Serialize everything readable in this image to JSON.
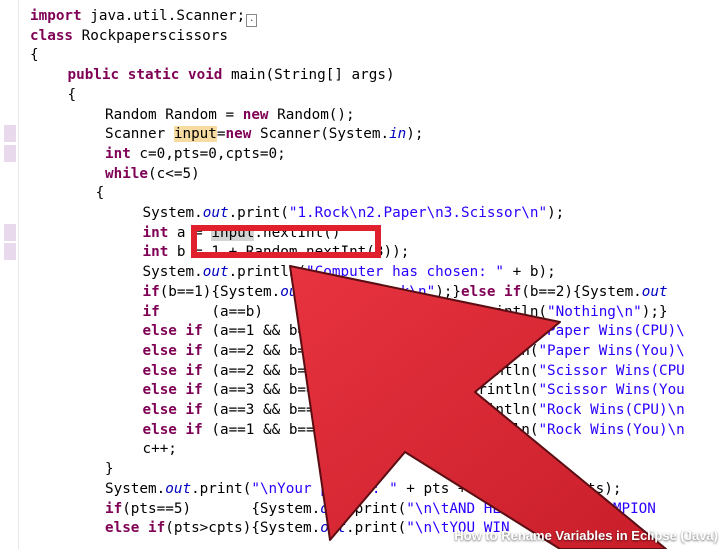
{
  "editor": {
    "lines": [
      {
        "indent": 0,
        "tokens": [
          [
            "kw",
            "import"
          ],
          [
            "t",
            " java.util.Scanner;"
          ]
        ],
        "fold": true
      },
      {
        "indent": 0,
        "tokens": [
          [
            "kw",
            "class"
          ],
          [
            "t",
            " Rockpaperscissors"
          ]
        ]
      },
      {
        "indent": 0,
        "tokens": [
          [
            "t",
            "{"
          ]
        ]
      },
      {
        "indent": 4,
        "tokens": [
          [
            "kw",
            "public static void"
          ],
          [
            "t",
            " main(String[] args)"
          ]
        ]
      },
      {
        "indent": 4,
        "tokens": [
          [
            "t",
            "{"
          ]
        ]
      },
      {
        "indent": 8,
        "tokens": [
          [
            "t",
            "Random Random = "
          ],
          [
            "kw",
            "new"
          ],
          [
            "t",
            " Random();"
          ]
        ]
      },
      {
        "indent": 8,
        "tokens": [
          [
            "t",
            "Scanner "
          ],
          [
            "occw",
            "input"
          ],
          [
            "t",
            "="
          ],
          [
            "kw",
            "new"
          ],
          [
            "t",
            " Scanner(System."
          ],
          [
            "fld",
            "in"
          ],
          [
            "t",
            ");"
          ]
        ],
        "mark": true
      },
      {
        "indent": 8,
        "tokens": [
          [
            "kw",
            "int"
          ],
          [
            "t",
            " c=0,pts=0,cpts=0;"
          ]
        ],
        "mark": true
      },
      {
        "indent": 8,
        "tokens": [
          [
            "kw",
            "while"
          ],
          [
            "t",
            "(c<=5)"
          ]
        ]
      },
      {
        "indent": 7,
        "tokens": [
          [
            "t",
            "{"
          ]
        ]
      },
      {
        "indent": 12,
        "tokens": [
          [
            "t",
            "System."
          ],
          [
            "fld",
            "out"
          ],
          [
            "t",
            ".print("
          ],
          [
            "str",
            "\"1.Rock\\n2.Paper\\n3.Scissor\\n\""
          ],
          [
            "t",
            ");"
          ]
        ]
      },
      {
        "indent": 12,
        "tokens": [
          [
            "kw",
            "int"
          ],
          [
            "t",
            " a = "
          ],
          [
            "occr",
            "input"
          ],
          [
            "t",
            ".nextInt()"
          ]
        ],
        "mark": true
      },
      {
        "indent": 12,
        "tokens": [
          [
            "kw",
            "int"
          ],
          [
            "t",
            " b = 1 + Random.nextInt(3));"
          ]
        ],
        "mark": true
      },
      {
        "indent": 12,
        "tokens": [
          [
            "t",
            "System."
          ],
          [
            "fld",
            "out"
          ],
          [
            "t",
            ".println("
          ],
          [
            "str",
            "\"Computer has chosen: \""
          ],
          [
            "t",
            " + b);"
          ]
        ]
      },
      {
        "indent": 12,
        "tokens": [
          [
            "kw",
            "if"
          ],
          [
            "t",
            "(b==1){System."
          ],
          [
            "fld",
            "out"
          ],
          [
            "t",
            ".print("
          ],
          [
            "str",
            "\"Rock\\n\""
          ],
          [
            "t",
            ");}"
          ],
          [
            "kw",
            "else if"
          ],
          [
            "t",
            "(b==2){System."
          ],
          [
            "fld",
            "out"
          ]
        ]
      },
      {
        "indent": 12,
        "tokens": [
          [
            "kw",
            "if"
          ],
          [
            "t",
            "      (a==b)                        .println("
          ],
          [
            "str",
            "\"Nothing\\n\""
          ],
          [
            "t",
            ");}"
          ]
        ]
      },
      {
        "indent": 12,
        "tokens": [
          [
            "kw",
            "else if"
          ],
          [
            "t",
            " (a==1 && b==3)     System."
          ],
          [
            "fld",
            "out"
          ],
          [
            "t",
            ".println("
          ],
          [
            "str",
            "\"Paper Wins(CPU)\\"
          ]
        ]
      },
      {
        "indent": 12,
        "tokens": [
          [
            "kw",
            "else if"
          ],
          [
            "t",
            " (a==2 && b==1)     System."
          ],
          [
            "fld",
            "out"
          ],
          [
            "t",
            ".println("
          ],
          [
            "str",
            "\"Paper Wins(You)\\"
          ]
        ]
      },
      {
        "indent": 12,
        "tokens": [
          [
            "kw",
            "else if"
          ],
          [
            "t",
            " (a==2 && b==3)     System."
          ],
          [
            "fld",
            "out"
          ],
          [
            "t",
            ".println("
          ],
          [
            "str",
            "\"Scissor Wins(CPU"
          ]
        ]
      },
      {
        "indent": 12,
        "tokens": [
          [
            "kw",
            "else if"
          ],
          [
            "t",
            " (a==3 && b==2)     System."
          ],
          [
            "fld",
            "out"
          ],
          [
            "t",
            ".println("
          ],
          [
            "str",
            "\"Scissor Wins(You"
          ]
        ]
      },
      {
        "indent": 12,
        "tokens": [
          [
            "kw",
            "else if"
          ],
          [
            "t",
            " (a==3 && b==1)     System."
          ],
          [
            "fld",
            "out"
          ],
          [
            "t",
            ".println("
          ],
          [
            "str",
            "\"Rock Wins(CPU)\\n"
          ]
        ]
      },
      {
        "indent": 12,
        "tokens": [
          [
            "kw",
            "else if"
          ],
          [
            "t",
            " (a==1 && b==3 )    System."
          ],
          [
            "fld",
            "out"
          ],
          [
            "t",
            ".println("
          ],
          [
            "str",
            "\"Rock Wins(You)\\n"
          ]
        ]
      },
      {
        "indent": 12,
        "tokens": [
          [
            "t",
            "c++;"
          ]
        ]
      },
      {
        "indent": 8,
        "tokens": [
          [
            "t",
            "}"
          ]
        ]
      },
      {
        "indent": 8,
        "tokens": [
          [
            "t",
            "System."
          ],
          [
            "fld",
            "out"
          ],
          [
            "t",
            ".print("
          ],
          [
            "str",
            "\"\\nYour points: \""
          ],
          [
            "t",
            " + pts + "
          ],
          [
            "str",
            "\" CPU: \""
          ],
          [
            "t",
            " + cpts);"
          ]
        ]
      },
      {
        "indent": 8,
        "tokens": [
          [
            "kw",
            "if"
          ],
          [
            "t",
            "(pts==5)       {System."
          ],
          [
            "fld",
            "out"
          ],
          [
            "t",
            ".print("
          ],
          [
            "str",
            "\"\\n\\tAND HERE IS THE CHAMPION"
          ]
        ]
      },
      {
        "indent": 8,
        "tokens": [
          [
            "kw",
            "else if"
          ],
          [
            "t",
            "(pts>cpts){System."
          ],
          [
            "fld",
            "out"
          ],
          [
            "t",
            ".print("
          ],
          [
            "str",
            "\"\\n\\tYOU WIN"
          ]
        ]
      }
    ]
  },
  "caption": "How to Rename Variables in Eclipse (Java)",
  "colors": {
    "accent_red": "#e0202d",
    "keyword": "#7f0055",
    "string": "#2a00ff",
    "field": "#0000c0",
    "occurrence_write": "#f6dca0",
    "occurrence_read": "#d4d4d4",
    "gutter_marker": "#e9d9ec"
  }
}
